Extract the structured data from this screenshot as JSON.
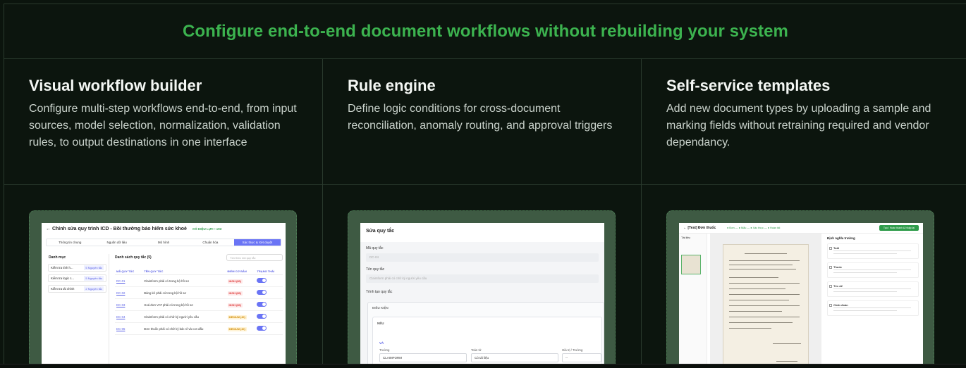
{
  "hero": {
    "title": "Configure end-to-end document workflows without rebuilding your system"
  },
  "features": [
    {
      "title": "Visual workflow builder",
      "description": "Configure multi-step workflows end-to-end, from input sources, model selection, normalization, validation rules, to output destinations in one interface"
    },
    {
      "title": "Rule engine",
      "description": "Define logic conditions for cross-document reconciliation, anomaly routing, and approval triggers"
    },
    {
      "title": "Self-service templates",
      "description": "Add new document types by uploading a sample and marking fields without retraining required and vendor dependancy."
    }
  ],
  "shot1": {
    "title": "← Chỉnh sửa quy trình ICD - Bồi thường bảo hiểm sức khoẻ",
    "badge": "CÓ HIỆU LỰC • v02",
    "steps": [
      "Thông tin chung",
      "Nguồn dữ liệu",
      "Mô hình",
      "Chuẩn hóa",
      "Xác thực & Xét duyệt"
    ],
    "side_heading": "Danh mục",
    "side_items": [
      {
        "label": "Kiểm tra tính h...",
        "badge": "5 Nguyên tắc"
      },
      {
        "label": "Kiểm tra logic c...",
        "badge": "5 Nguyên tắc"
      },
      {
        "label": "Kiểm tra tài chính",
        "badge": "2 Nguyên tắc"
      }
    ],
    "list_heading": "Danh sách quy tắc (5)",
    "search_placeholder": "Tìm theo mã quy tắc",
    "columns": [
      "MÃ QUY TẮC",
      "TÊN QUY TẮC",
      "ĐIỂM CƠ BẢN",
      "TRẠNG THÁI"
    ],
    "rows": [
      {
        "code": "DC-01",
        "name": "Claimform phải có trong bộ hồ sơ",
        "level": "HIGH (80)",
        "sev": "high"
      },
      {
        "code": "DC-02",
        "name": "Bảng kê phải có trong bộ hồ sơ",
        "level": "HIGH (80)",
        "sev": "high"
      },
      {
        "code": "DC-03",
        "name": "Hoá đơn VAT phải có trong bộ hồ sơ",
        "level": "HIGH (80)",
        "sev": "high"
      },
      {
        "code": "DC-04",
        "name": "Claimform phải có chữ ký người yêu cầu",
        "level": "MEDIUM (40)",
        "sev": "med"
      },
      {
        "code": "DC-05",
        "name": "Đơn thuốc phải có chữ ký bác sĩ và con dấu",
        "level": "MEDIUM (40)",
        "sev": "med"
      }
    ]
  },
  "shot2": {
    "title": "Sửa quy tắc",
    "code_label": "Mã quy tắc",
    "code_value": "DC-04",
    "name_label": "Tên quy tắc",
    "name_value": "Claimform phải có chữ ký người yêu cầu",
    "trigger_label": "Trình tạo quy tắc",
    "condition_heading": "ĐIỀU KIỆN",
    "if_label": "NẾU",
    "and_label": "VÀ",
    "field_label": "Trường",
    "field_value": "CLAIMFORM",
    "operator_label": "Toán tử",
    "operator_value": "Có tài liệu",
    "value_label": "Giá trị / Trường",
    "value_value": "--"
  },
  "shot3": {
    "title": "← [Test] Đơn thuốc",
    "steps": "● Đơn — ● Mẫu — ● Xác thực — ● Hoàn tất",
    "button": "Tạo / Hoàn thành & Nhập lại",
    "left_label": "Tài liệu",
    "right_heading": "Định nghĩa trường",
    "fields": [
      "Tuổi",
      "Thuốc",
      "Tên dể",
      "Chẩn đoán"
    ]
  }
}
